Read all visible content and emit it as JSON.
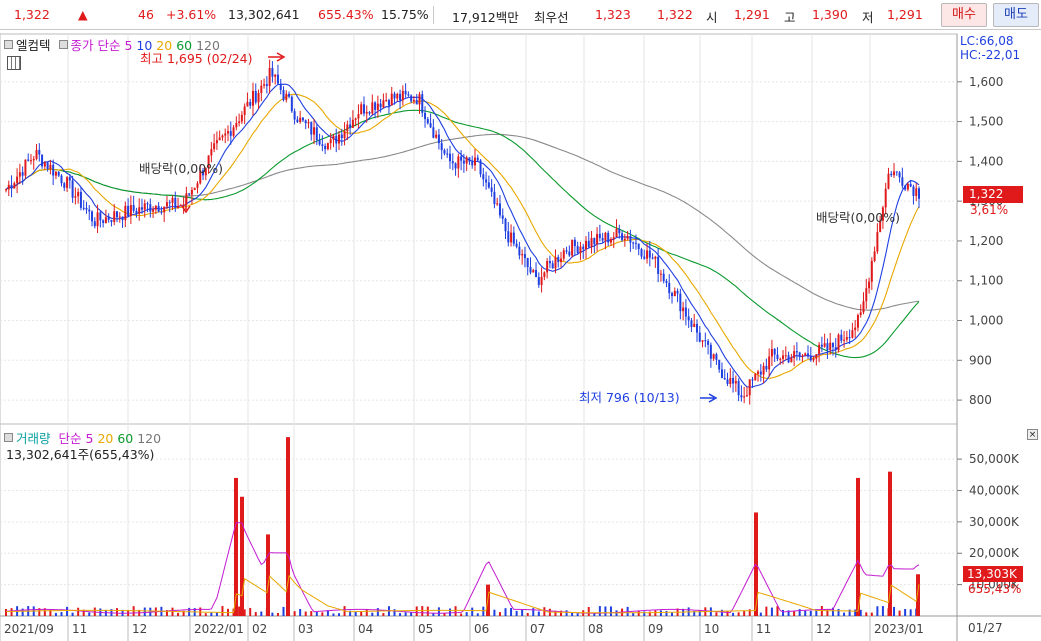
{
  "ticker": {
    "price": "1,322",
    "arrow": "▲",
    "change": "46",
    "change_pct": "+3.61%",
    "volume": "13,302,641",
    "volume_ratio": "655.43%",
    "turnover": "15.75%",
    "amount": "17,912백만",
    "best_ask_label": "최우선",
    "best_ask": "1,323",
    "best_bid": "1,322",
    "open_label": "시",
    "open": "1,291",
    "high_label": "고",
    "high": "1,390",
    "low_label": "저",
    "low": "1,291",
    "buy_label": "매수",
    "sell_label": "매도"
  },
  "price_panel": {
    "name": "엘컴텍",
    "ma_label": "종가 단순",
    "ma_periods": [
      "5",
      "10",
      "20",
      "60",
      "120"
    ],
    "lc": "LC:66,08",
    "hc": "HC:-22,01",
    "high_note": "최고 1,695 (02/24)",
    "low_note": "최저 796 (10/13)",
    "dividend_note_1": "배당락(0,00%)",
    "dividend_note_2": "배당락(0,00%)",
    "current_price": "1,322",
    "current_pct": "3,61%"
  },
  "volume_panel": {
    "name": "거래량",
    "ma_label": "단순",
    "ma_periods": [
      "5",
      "20",
      "60",
      "120"
    ],
    "summary": "13,302,641주(655,43%)",
    "current_volume": "13,303K",
    "current_pct": "655,43%"
  },
  "x_axis": {
    "labels": [
      "2021/09",
      "11",
      "12",
      "2022/01",
      "02",
      "03",
      "04",
      "05",
      "06",
      "07",
      "08",
      "09",
      "10",
      "11",
      "12",
      "2023/01"
    ],
    "right_label": "01/27"
  },
  "chart_data": {
    "type": "candlestick",
    "price_axis": {
      "ticks": [
        "1,600",
        "1,500",
        "1,400",
        "1,300",
        "1,200",
        "1,100",
        "1,000",
        "900",
        "800"
      ],
      "ylim": [
        760,
        1700
      ]
    },
    "volume_axis": {
      "ticks": [
        "50,000K",
        "40,000K",
        "30,000K",
        "20,000K",
        "10,000K"
      ],
      "ylim": [
        0,
        58000
      ]
    },
    "close_anchors": [
      [
        "2021/09",
        1330
      ],
      [
        "2021/10",
        1420
      ],
      [
        "2021/11",
        1350
      ],
      [
        "2021/11b",
        1250
      ],
      [
        "2021/12",
        1270
      ],
      [
        "2021/12b",
        1290
      ],
      [
        "2022/01",
        1290
      ],
      [
        "2022/01b",
        1420
      ],
      [
        "2022/02",
        1520
      ],
      [
        "2022/02b",
        1620
      ],
      [
        "2022/03",
        1500
      ],
      [
        "2022/03b",
        1440
      ],
      [
        "2022/04",
        1530
      ],
      [
        "2022/04b",
        1560
      ],
      [
        "2022/05",
        1560
      ],
      [
        "2022/05b",
        1400
      ],
      [
        "2022/06",
        1390
      ],
      [
        "2022/06b",
        1220
      ],
      [
        "2022/07",
        1100
      ],
      [
        "2022/07b",
        1180
      ],
      [
        "2022/08",
        1200
      ],
      [
        "2022/08b",
        1220
      ],
      [
        "2022/09",
        1150
      ],
      [
        "2022/09b",
        1030
      ],
      [
        "2022/10",
        900
      ],
      [
        "2022/10b",
        810
      ],
      [
        "2022/11",
        910
      ],
      [
        "2022/11b",
        910
      ],
      [
        "2022/12",
        930
      ],
      [
        "2022/12b",
        1000
      ],
      [
        "2023/01",
        1380
      ],
      [
        "2023/01b",
        1322
      ]
    ],
    "volume_spikes": [
      {
        "x": "2022/01",
        "value": 44000
      },
      {
        "x": "2022/01b",
        "value": 38000
      },
      {
        "x": "2022/02",
        "value": 26000
      },
      {
        "x": "2022/02b",
        "value": 57000
      },
      {
        "x": "2022/06",
        "value": 10000
      },
      {
        "x": "2022/11",
        "value": 33000
      },
      {
        "x": "2022/12b",
        "value": 44000
      },
      {
        "x": "2023/01",
        "value": 46000
      },
      {
        "x": "2023/01b",
        "value": 13303
      }
    ]
  }
}
